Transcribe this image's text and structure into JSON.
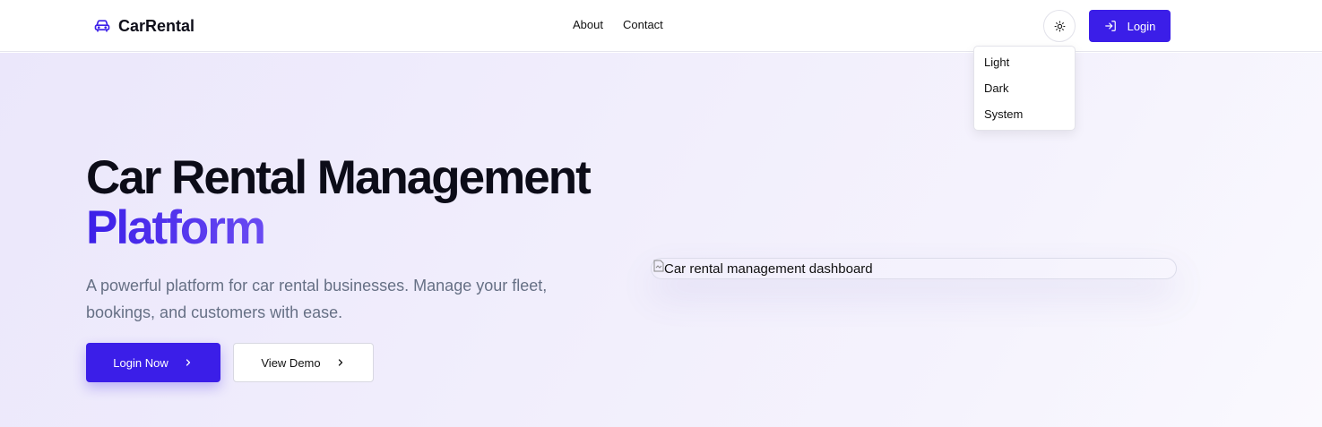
{
  "header": {
    "brand": "CarRental",
    "nav": [
      {
        "label": "About"
      },
      {
        "label": "Contact"
      }
    ],
    "theme_icon": "sun-icon",
    "login_label": "Login"
  },
  "theme_menu": {
    "items": [
      {
        "label": "Light"
      },
      {
        "label": "Dark"
      },
      {
        "label": "System"
      }
    ]
  },
  "hero": {
    "title_line1": "Car Rental Management",
    "title_line2": "Platform",
    "subtitle": "A powerful platform for car rental businesses. Manage your fleet, bookings, and customers with ease.",
    "primary_cta": "Login Now",
    "secondary_cta": "View Demo",
    "image_alt": "Car rental management dashboard"
  },
  "colors": {
    "accent": "#3b1ee8",
    "accent_light": "#6a4bf2",
    "subtitle_text": "#667085"
  }
}
